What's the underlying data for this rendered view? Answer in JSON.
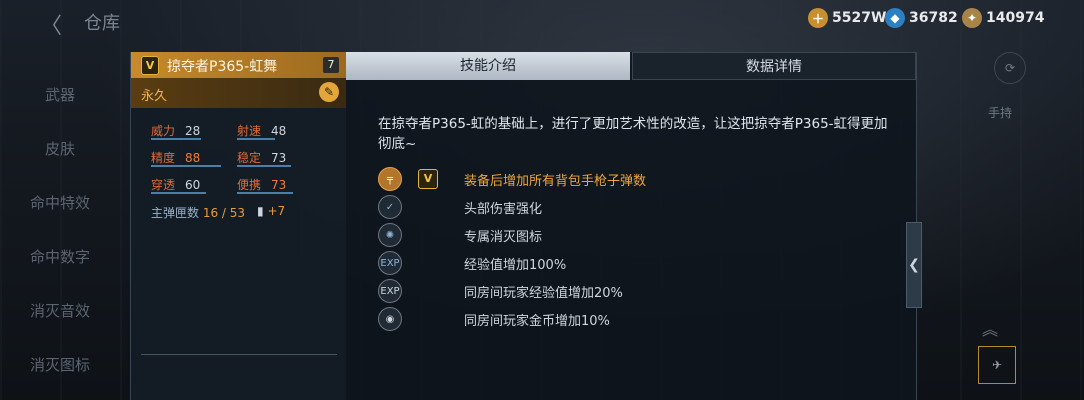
{
  "header": {
    "back_glyph": "〈",
    "title": "仓库"
  },
  "currencies": [
    {
      "icon": "gold-plus-icon",
      "value": "5527W",
      "color": "#d9a94a"
    },
    {
      "icon": "diamond-icon",
      "value": "36782",
      "color": "#8fd0ff"
    },
    {
      "icon": "medal-icon",
      "value": "140974",
      "color": "#c8a060"
    }
  ],
  "left_nav": [
    "武器",
    "皮肤",
    "命中特效",
    "命中数字",
    "消灭音效",
    "消灭图标"
  ],
  "weapon": {
    "badge": "V",
    "name": "掠夺者P365-虹舞",
    "count": "7",
    "duration": "永久",
    "stats": [
      {
        "key": "威力",
        "value": "28",
        "value_color": "#cfd6de"
      },
      {
        "key": "射速",
        "value": "48",
        "value_color": "#cfd6de"
      },
      {
        "key": "精度",
        "value": "88",
        "value_color": "#f07b3a"
      },
      {
        "key": "稳定",
        "value": "73",
        "value_color": "#cfd6de"
      },
      {
        "key": "穿透",
        "value": "60",
        "value_color": "#cfd6de"
      },
      {
        "key": "便携",
        "value": "73",
        "value_color": "#f07b3a"
      }
    ],
    "ammo_label": "主弹匣数",
    "ammo_value": "16 / 53",
    "ammo_bonus": "+7"
  },
  "tabs": {
    "skills": "技能介绍",
    "details": "数据详情"
  },
  "description": "在掠夺者P365-虹的基础上，进行了更加艺术性的改造，让这把掠夺者P365-虹得更加彻底~",
  "skills": [
    {
      "icon": "pistol-icon",
      "badge": "V",
      "label": "装备后增加所有背包手枪子弹数",
      "color": "#f0a63a"
    },
    {
      "icon": "headshot-icon",
      "label": "头部伤害强化",
      "color": "#dfe5eb"
    },
    {
      "icon": "kill-mark-icon",
      "label": "专属消灭图标",
      "color": "#dfe5eb"
    },
    {
      "icon": "exp-icon",
      "label": "经验值增加100%",
      "color": "#dfe5eb"
    },
    {
      "icon": "room-exp-icon",
      "label": "同房间玩家经验值增加20%",
      "color": "#dfe5eb"
    },
    {
      "icon": "room-coin-icon",
      "label": "同房间玩家金币增加10%",
      "color": "#dfe5eb"
    }
  ],
  "right_side": {
    "hand_label": "手持"
  }
}
